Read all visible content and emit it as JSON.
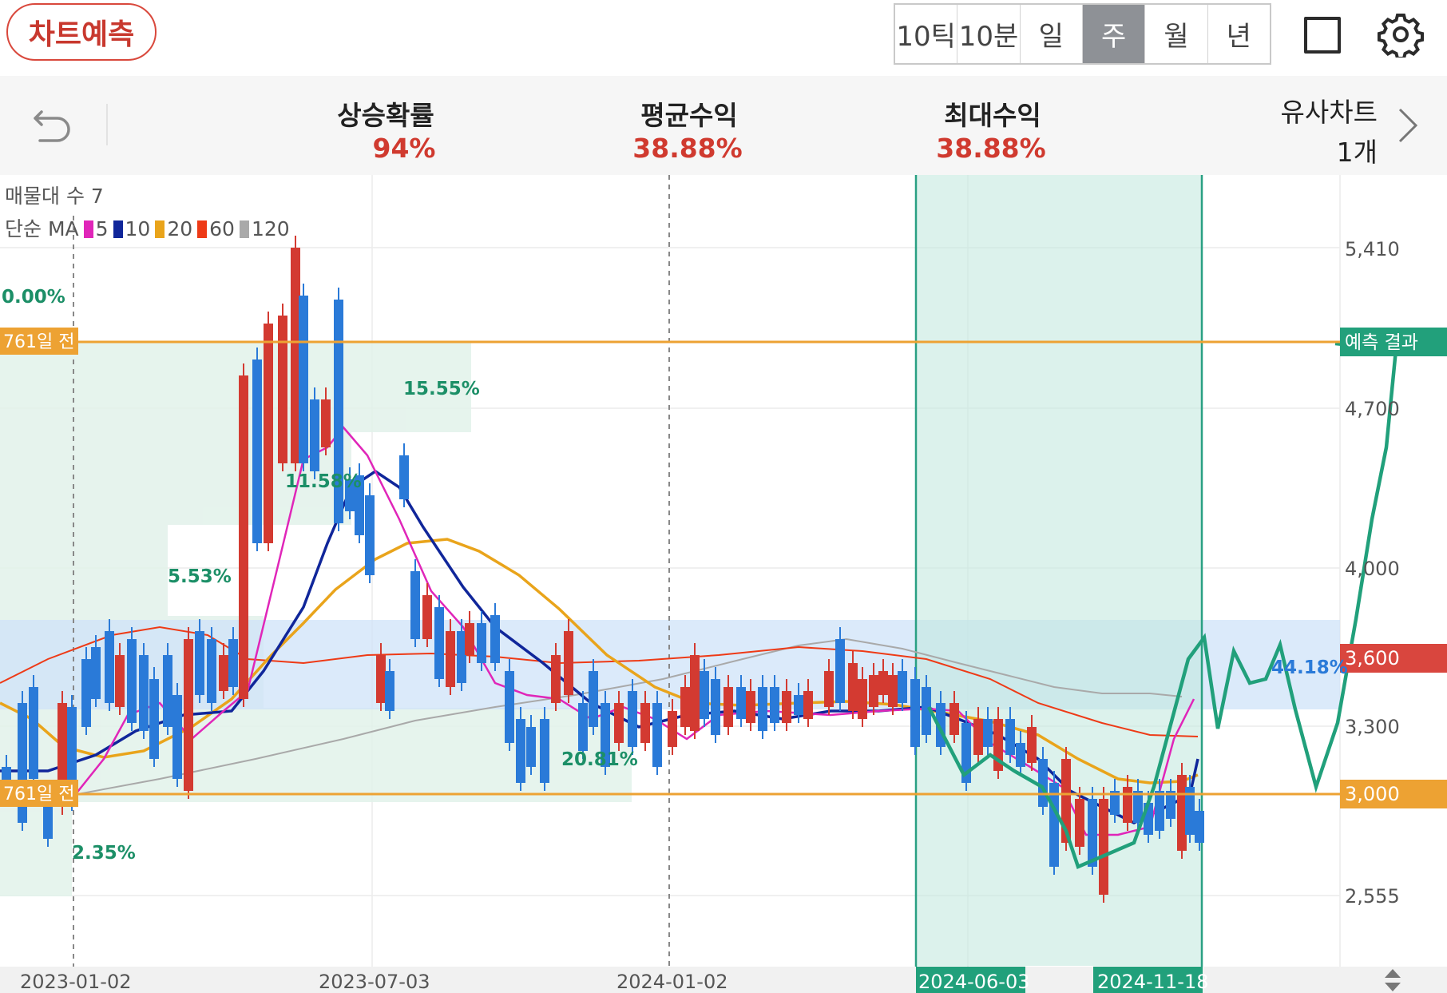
{
  "header": {
    "predict_button": "차트예측",
    "period_tabs": [
      "10틱",
      "10분",
      "일",
      "주",
      "월",
      "년"
    ],
    "active_tab": "주"
  },
  "stats": {
    "rise_prob_label": "상승확률",
    "rise_prob_value": "94%",
    "avg_return_label": "평균수익",
    "avg_return_value": "38.88%",
    "max_return_label": "최대수익",
    "max_return_value": "38.88%",
    "similar_label": "유사차트",
    "similar_value": "1개"
  },
  "legend": {
    "volume_profile": "매물대 수 7",
    "ma_label": "단순 MA",
    "ma_items": [
      {
        "label": "5",
        "color": "#e026b9"
      },
      {
        "label": "10",
        "color": "#10269a"
      },
      {
        "label": "20",
        "color": "#e9a41b"
      },
      {
        "label": "60",
        "color": "#ee3a16"
      },
      {
        "label": "120",
        "color": "#a9a9a9"
      }
    ]
  },
  "chart_data": {
    "type": "candlestick",
    "y_ticks": [
      "5,410",
      "4,700",
      "4,000",
      "3,300",
      "2,555"
    ],
    "x_ticks": [
      "2023-01-02",
      "2023-07-03",
      "2024-01-02"
    ],
    "highlight_dates": [
      "2024-06-03",
      "2024-11-18"
    ],
    "price_labels": [
      {
        "text": "3,600",
        "color": "#d9463e"
      },
      {
        "text": "3,000",
        "color": "#eda233"
      }
    ],
    "result_label": "예측 결과",
    "day_labels": [
      "761일 전",
      "761일 전"
    ],
    "volume_pcts": [
      "0.00%",
      "15.55%",
      "11.58%",
      "5.53%",
      "20.81%",
      "2.35%"
    ],
    "match_pct": "44.18%",
    "colors": {
      "up": "#d33a31",
      "down": "#2a7ad8",
      "predict": "#23a07a"
    }
  }
}
